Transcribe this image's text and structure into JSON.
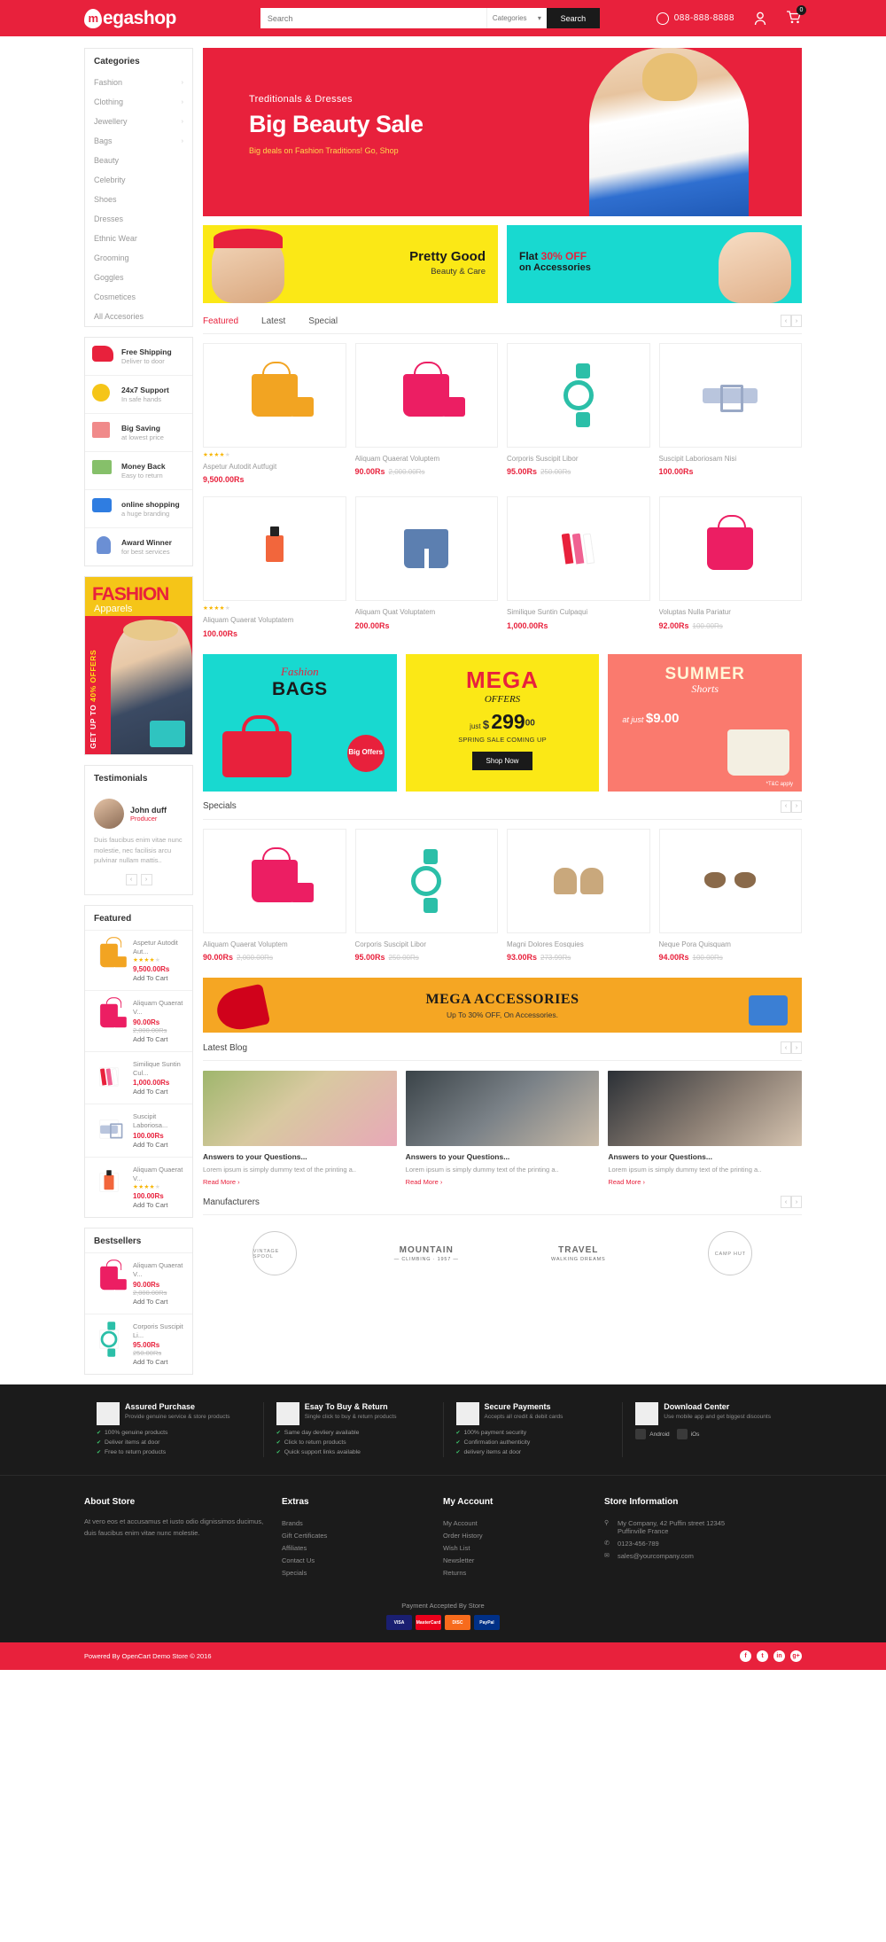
{
  "header": {
    "logo_text": "egashop",
    "logo_mark": "m",
    "search_placeholder": "Search",
    "categories_label": "Categories",
    "search_button": "Search",
    "phone": "088-888-8888",
    "cart_count": "0",
    "icons": {
      "phone": "phone-icon",
      "account": "user-icon",
      "cart": "cart-icon"
    }
  },
  "sidebar": {
    "categories_title": "Categories",
    "categories": [
      {
        "label": "Fashion",
        "has_children": true
      },
      {
        "label": "Clothing",
        "has_children": true
      },
      {
        "label": "Jewellery",
        "has_children": true
      },
      {
        "label": "Bags",
        "has_children": true
      },
      {
        "label": "Beauty",
        "has_children": false
      },
      {
        "label": "Celebrity",
        "has_children": false
      },
      {
        "label": "Shoes",
        "has_children": false
      },
      {
        "label": "Dresses",
        "has_children": false
      },
      {
        "label": "Ethnic Wear",
        "has_children": false
      },
      {
        "label": "Grooming",
        "has_children": false
      },
      {
        "label": "Goggles",
        "has_children": false
      },
      {
        "label": "Cosmetices",
        "has_children": false
      },
      {
        "label": "All Accesories",
        "has_children": false
      }
    ],
    "services": [
      {
        "title": "Free Shipping",
        "sub": "Deliver to door",
        "icon": "scooter-icon"
      },
      {
        "title": "24x7 Support",
        "sub": "In safe hands",
        "icon": "headset-icon"
      },
      {
        "title": "Big Saving",
        "sub": "at lowest price",
        "icon": "gift-icon"
      },
      {
        "title": "Money Back",
        "sub": "Easy to return",
        "icon": "money-icon"
      },
      {
        "title": "online shopping",
        "sub": "a huge branding",
        "icon": "cart-truck-icon"
      },
      {
        "title": "Award Winner",
        "sub": "for best services",
        "icon": "trophy-icon"
      }
    ],
    "fashion_banner": {
      "title": "FASHION",
      "subtitle": "Apparels",
      "side_text": "GET UP TO",
      "side_offer": "40% OFFERS"
    },
    "testimonials_title": "Testimonials",
    "testimonial": {
      "name": "John duff",
      "role": "Producer",
      "text": "Duis faucibus enim vitae nunc molestie, nec facilisis arcu pulvinar nullam mattis.."
    },
    "featured_title": "Featured",
    "featured_items": [
      {
        "name": "Aspetur Autodit Aut...",
        "price": "9,500.00Rs",
        "old": "",
        "cart": "Add To Cart",
        "stars": 4,
        "icon": "orange-bag-icon"
      },
      {
        "name": "Aliquam Quaerat V...",
        "price": "90.00Rs",
        "old": "2,000.00Rs",
        "cart": "Add To Cart",
        "stars": 0,
        "icon": "pink-bag-icon"
      },
      {
        "name": "Similique Suntin Cul...",
        "price": "1,000.00Rs",
        "old": "",
        "cart": "Add To Cart",
        "stars": 0,
        "icon": "lipstick-icon"
      },
      {
        "name": "Suscipit Laboriosa...",
        "price": "100.00Rs",
        "old": "",
        "cart": "Add To Cart",
        "stars": 0,
        "icon": "belt-icon"
      },
      {
        "name": "Aliquam Quaerat V...",
        "price": "100.00Rs",
        "old": "",
        "cart": "Add To Cart",
        "stars": 4,
        "icon": "nailpolish-icon"
      }
    ],
    "bestsellers_title": "Bestsellers",
    "bestseller_items": [
      {
        "name": "Aliquam Quaerat V...",
        "price": "90.00Rs",
        "old": "2,000.00Rs",
        "cart": "Add To Cart",
        "stars": 0,
        "icon": "pink-bag-icon"
      },
      {
        "name": "Corporis Suscipit Li...",
        "price": "95.00Rs",
        "old": "250.00Rs",
        "cart": "Add To Cart",
        "stars": 0,
        "icon": "watch-icon"
      }
    ]
  },
  "hero": {
    "sub": "Treditionals & Dresses",
    "title": "Big Beauty Sale",
    "note": "Big deals on Fashion Traditions! Go, Shop"
  },
  "promo_two": {
    "left": {
      "line1": "Pretty Good",
      "line2": "Beauty & Care"
    },
    "right": {
      "line1_pre": "Flat ",
      "line1_em": "30% OFF",
      "line2": "on Accessories"
    }
  },
  "featured_section": {
    "tabs": [
      {
        "label": "Featured",
        "active": true
      },
      {
        "label": "Latest",
        "active": false
      },
      {
        "label": "Special",
        "active": false
      }
    ],
    "row1": [
      {
        "name": "Aspetur Autodit Autfugit",
        "price": "9,500.00Rs",
        "old": "",
        "stars": 4,
        "icon": "orange-bag-icon"
      },
      {
        "name": "Aliquam Quaerat Voluptem",
        "price": "90.00Rs",
        "old": "2,000.00Rs",
        "stars": 0,
        "icon": "pink-bag-icon"
      },
      {
        "name": "Corporis Suscipit Libor",
        "price": "95.00Rs",
        "old": "250.00Rs",
        "stars": 0,
        "icon": "watch-icon"
      },
      {
        "name": "Suscipit Laboriosam Nisi",
        "price": "100.00Rs",
        "old": "",
        "stars": 0,
        "icon": "belt-icon"
      }
    ],
    "row2": [
      {
        "name": "Aliquam Quaerat Voluptatem",
        "price": "100.00Rs",
        "old": "",
        "stars": 4,
        "icon": "nailpolish-icon"
      },
      {
        "name": "Aliquam Quat Voluptatem",
        "price": "200.00Rs",
        "old": "",
        "stars": 0,
        "icon": "denim-shorts-icon"
      },
      {
        "name": "Similique Suntin Culpaqui",
        "price": "1,000.00Rs",
        "old": "",
        "stars": 0,
        "icon": "lipstick-icon"
      },
      {
        "name": "Voluptas Nulla Pariatur",
        "price": "92.00Rs",
        "old": "100.00Rs",
        "stars": 0,
        "icon": "pink-handbag-icon"
      }
    ]
  },
  "promo_three": {
    "bags": {
      "script": "Fashion",
      "title": "BAGS",
      "badge": "Big Offers"
    },
    "mega": {
      "title": "MEGA",
      "sub": "OFFERS",
      "just": "just",
      "currency": "$",
      "price": "299",
      "cents": "00",
      "line": "SPRING SALE COMING UP",
      "button": "Shop Now"
    },
    "summer": {
      "title": "SUMMER",
      "sub": "Shorts",
      "at_just": "at just",
      "price": "$9.00",
      "tc": "*T&C apply"
    }
  },
  "specials_section": {
    "title": "Specials",
    "items": [
      {
        "name": "Aliquam Quaerat Voluptem",
        "price": "90.00Rs",
        "old": "2,000.00Rs",
        "icon": "pink-bag-icon"
      },
      {
        "name": "Corporis Suscipit Libor",
        "price": "95.00Rs",
        "old": "250.00Rs",
        "icon": "watch-icon"
      },
      {
        "name": "Magni Dolores Eosquies",
        "price": "93.00Rs",
        "old": "273.99Rs",
        "icon": "boots-icon"
      },
      {
        "name": "Neque Pora Quisquam",
        "price": "94.00Rs",
        "old": "100.00Rs",
        "icon": "sunglasses-icon"
      }
    ]
  },
  "mega_accessories": {
    "title": "MEGA ACCESSORIES",
    "sub": "Up To 30% OFF, On Accessories."
  },
  "blog_section": {
    "title": "Latest Blog",
    "posts": [
      {
        "title": "Answers to your Questions...",
        "text": "Lorem ipsum is simply dummy text of the printing a..",
        "more": "Read More ›"
      },
      {
        "title": "Answers to your Questions...",
        "text": "Lorem ipsum is simply dummy text of the printing a..",
        "more": "Read More ›"
      },
      {
        "title": "Answers to your Questions...",
        "text": "Lorem ipsum is simply dummy text of the printing a..",
        "more": "Read More ›"
      }
    ]
  },
  "manufacturers": {
    "title": "Manufacturers",
    "items": [
      {
        "name": "VINTAGE SPOOL",
        "sub": "VINTAGE SPOOL",
        "style": "circle"
      },
      {
        "name": "MOUNTAIN",
        "sub": "— CLIMBING · 1957 —",
        "style": "text"
      },
      {
        "name": "TRAVEL",
        "sub": "WALKING DREAMS",
        "style": "text"
      },
      {
        "name": "CAMP HUT",
        "sub": "CAMP HUT",
        "style": "circle"
      }
    ]
  },
  "footer_services": [
    {
      "title": "Assured Purchase",
      "sub": "Provide genuine service & store products",
      "icon": "bulb-icon",
      "items": [
        "100% genuine products",
        "Deliver items at door",
        "Free to return products"
      ]
    },
    {
      "title": "Esay To Buy & Return",
      "sub": "Single click to buy & return products",
      "icon": "box-icon",
      "items": [
        "Same day devliery available",
        "Click to return products",
        "Quick support links available"
      ]
    },
    {
      "title": "Secure Payments",
      "sub": "Accepts all credit & debit cards",
      "icon": "card-icon",
      "items": [
        "100% payment security",
        "Confirmation authenticity",
        "delivery items at door"
      ]
    },
    {
      "title": "Download Center",
      "sub": "Use mobile app and get biggest discounts",
      "icon": "mobile-icon",
      "buttons": [
        "Android",
        "iOs"
      ]
    }
  ],
  "footer": {
    "about": {
      "title": "About Store",
      "text": "At vero eos et accusamus et iusto odio dignissimos ducimus, duis faucibus enim vitae nunc molestie."
    },
    "extras": {
      "title": "Extras",
      "links": [
        "Brands",
        "Gift Certificates",
        "Affiliates",
        "Contact Us",
        "Specials"
      ]
    },
    "account": {
      "title": "My Account",
      "links": [
        "My Account",
        "Order History",
        "Wish List",
        "Newsletter",
        "Returns"
      ]
    },
    "store_info": {
      "title": "Store Information",
      "items": [
        {
          "icon": "pin-icon",
          "l1": "My Company, 42 Puffin street 12345",
          "l2": "Puffinville France"
        },
        {
          "icon": "phone-icon",
          "l1": "0123-456-789",
          "l2": ""
        },
        {
          "icon": "mail-icon",
          "l1": "sales@yourcompany.com",
          "l2": ""
        }
      ]
    },
    "payment_title": "Payment Accepted By Store",
    "payments": [
      {
        "label": "VISA",
        "color": "#1a1f71"
      },
      {
        "label": "MasterCard",
        "color": "#eb001b"
      },
      {
        "label": "DISC",
        "color": "#f76b1c"
      },
      {
        "label": "PayPal",
        "color": "#003087"
      }
    ],
    "copyright": "Powered By OpenCart Demo Store © 2016",
    "socials": [
      "f",
      "t",
      "in",
      "g+"
    ]
  },
  "colors": {
    "brand": "#e8213c",
    "dark": "#1b1b1b",
    "yellow": "#fbe816",
    "cyan": "#18d9d0"
  }
}
